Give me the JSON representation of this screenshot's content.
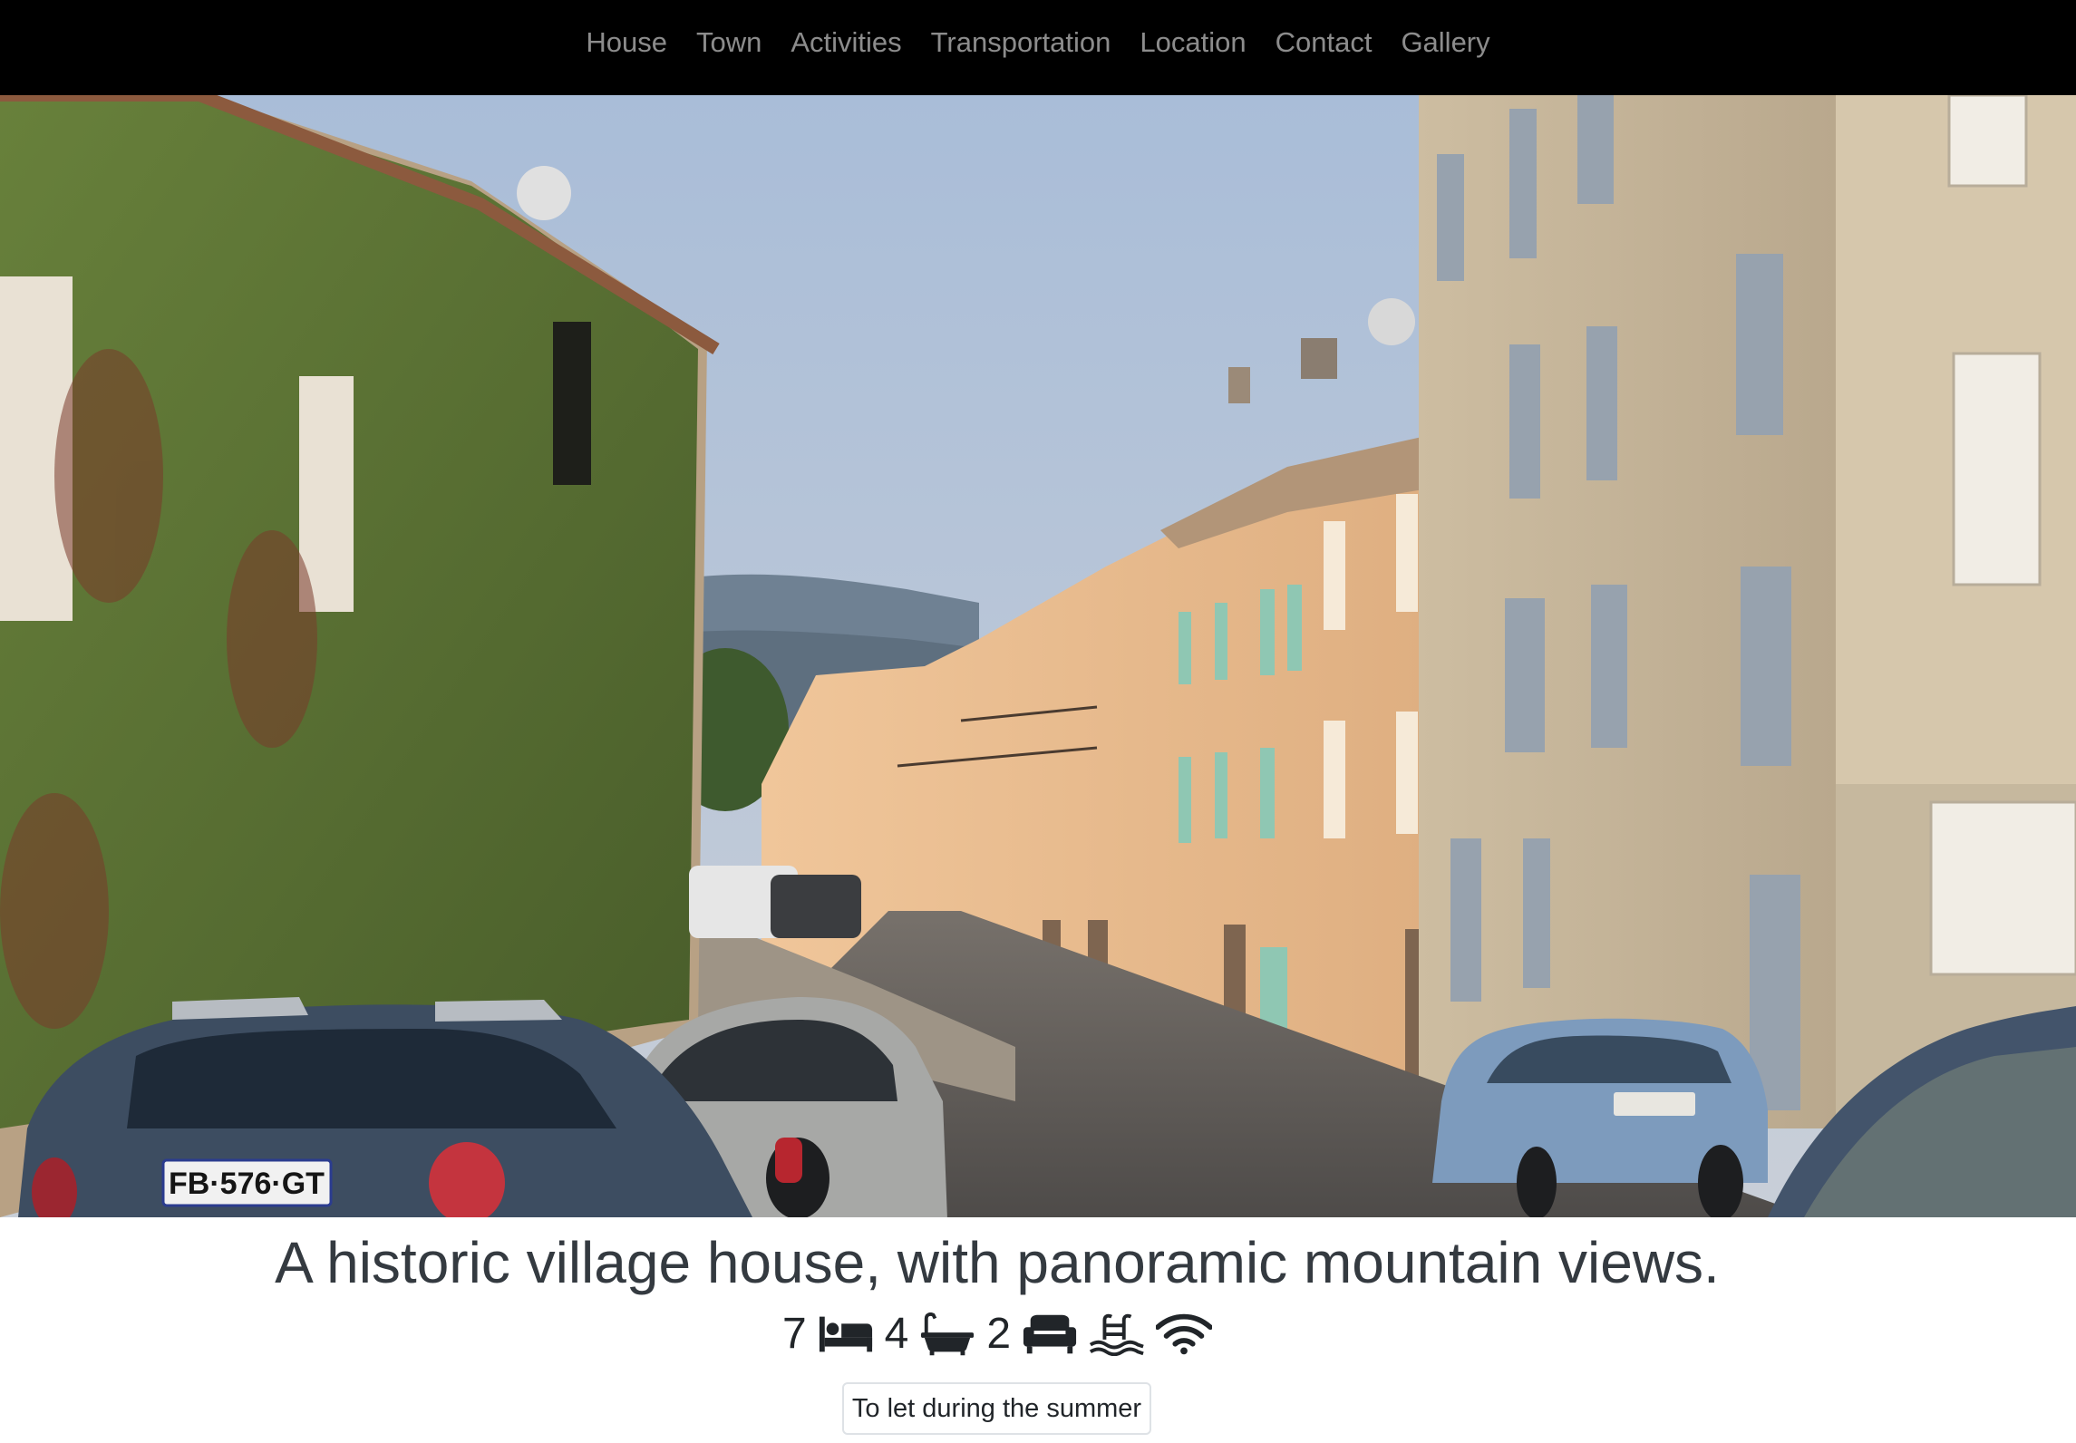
{
  "nav": {
    "items": [
      {
        "label": "House"
      },
      {
        "label": "Town"
      },
      {
        "label": "Activities"
      },
      {
        "label": "Transportation"
      },
      {
        "label": "Location"
      },
      {
        "label": "Contact"
      },
      {
        "label": "Gallery"
      }
    ]
  },
  "hero": {
    "plate_text": "FB·576·GT",
    "colors": {
      "sky_top": "#a9bdd8",
      "sky_bottom": "#c9cfd8",
      "mountain": "#6f8193",
      "ivy": "#4f6a2a",
      "stone": "#c9b79a",
      "ochre": "#e6b88a",
      "road": "#5e5a57",
      "blue_car": "#7d9bbd",
      "dark_car": "#3d4d61",
      "silver_car": "#a7a8a6"
    }
  },
  "headline": "A historic village house, with panoramic mountain views.",
  "amenities": {
    "bedrooms": "7",
    "bathrooms": "4",
    "living_rooms": "2",
    "icons": [
      "bed-icon",
      "bath-icon",
      "sofa-icon",
      "pool-icon",
      "wifi-icon"
    ]
  },
  "status_badge": "To let during the summer"
}
